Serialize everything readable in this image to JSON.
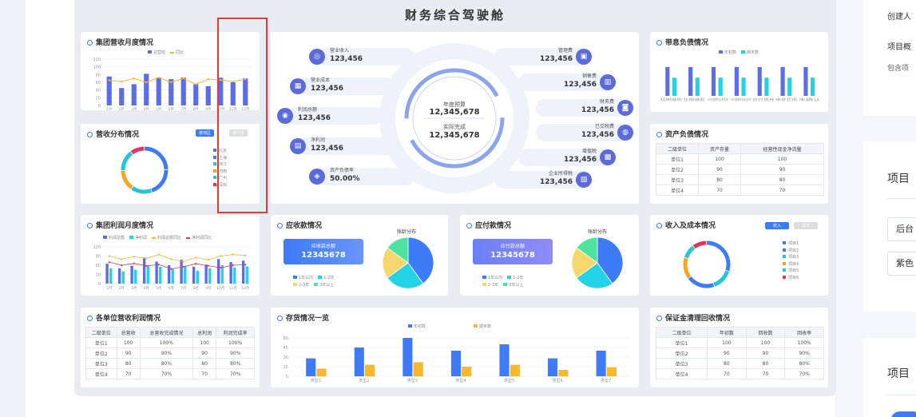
{
  "dashboard": {
    "title": "财务综合驾驶舱",
    "revenue_month": {
      "title": "集团营收月度情况",
      "legend": [
        "总营收",
        "同比"
      ],
      "y_ticks": [
        "120",
        "100",
        "80",
        "60",
        "40",
        "20",
        "0"
      ],
      "months": [
        "1月",
        "2月",
        "3月",
        "4月",
        "5月",
        "6月",
        "7月",
        "8月",
        "9月",
        "10月",
        "11月",
        "12月"
      ],
      "colors": {
        "bar": "#5b6ee8",
        "line": "#f5b830"
      }
    },
    "revenue_dist": {
      "title": "营收分布情况",
      "toggle": [
        "按地区",
        "按行业"
      ],
      "legend": [
        "北京",
        "上海",
        "浙江",
        "河南",
        "广州",
        "深圳"
      ],
      "colors": [
        "#3d7bf7",
        "#3d7bf7",
        "#22c6d6",
        "#f5a623",
        "#22c6d6",
        "#e8345a"
      ]
    },
    "center": {
      "budget_label": "年度预算",
      "budget_value": "12,345,678",
      "actual_label": "实际完成",
      "actual_value": "12,345,678",
      "left_items": [
        {
          "label": "营业收入",
          "value": "123,456",
          "icon": "◎"
        },
        {
          "label": "营业成本",
          "value": "123,456",
          "icon": "▦"
        },
        {
          "label": "利润总额",
          "value": "123,456",
          "icon": "◉"
        },
        {
          "label": "净利润",
          "value": "123,456",
          "icon": "▤"
        },
        {
          "label": "资产负债率",
          "value": "50.00%",
          "icon": "◈"
        }
      ],
      "right_items": [
        {
          "label": "管理费",
          "value": "123,456",
          "icon": "▣"
        },
        {
          "label": "销售费",
          "value": "123,456",
          "icon": "▥"
        },
        {
          "label": "财务费",
          "value": "123,456",
          "icon": "◙"
        },
        {
          "label": "已交税费",
          "value": "123,456",
          "icon": "◍"
        },
        {
          "label": "增值税",
          "value": "123,456",
          "icon": "▩"
        },
        {
          "label": "企业所得税",
          "value": "123,456",
          "icon": "▧"
        }
      ]
    },
    "debt_status": {
      "title": "带息负债情况",
      "legend": [
        "年初数",
        "期末数"
      ],
      "categories": [
        "短期借款",
        "长期借款",
        "一年内到期的长期负债",
        "一年内到期的非流动负债",
        "应付债券",
        "带息负债",
        "未确认"
      ]
    },
    "asset_debt": {
      "title": "资产负债情况",
      "headers": [
        "二级单位",
        "资产存量",
        "经营性现金净流量"
      ],
      "rows": [
        [
          "单位1",
          "100",
          "100"
        ],
        [
          "单位2",
          "90",
          "90"
        ],
        [
          "单位3",
          "80",
          "80"
        ],
        [
          "单位4",
          "70",
          "70"
        ]
      ]
    },
    "profit_month": {
      "title": "集团利润月度情况",
      "legend": [
        "利润总额",
        "净利润",
        "利润总额同比",
        "净利润同比"
      ],
      "y_ticks": [
        "120",
        "90",
        "60",
        "30",
        "0"
      ],
      "months": [
        "1月",
        "2月",
        "3月",
        "4月",
        "5月",
        "6月",
        "7月",
        "8月",
        "9月",
        "10月",
        "11月",
        "12月"
      ]
    },
    "receivable": {
      "title": "应收款情况",
      "box_label": "应收款总额",
      "box_value": "12345678",
      "age_title": "账龄分布",
      "legend": [
        "1年以内",
        "1-2年",
        "2-3年",
        "3年以上"
      ]
    },
    "payable": {
      "title": "应付款情况",
      "box_label": "应付款总额",
      "box_value": "12345678",
      "age_title": "账龄分布",
      "legend": [
        "1年以内",
        "1-2年",
        "2-3年",
        "3年以上"
      ]
    },
    "income_cost": {
      "title": "收入及成本情况",
      "toggle": [
        "收入",
        "成本"
      ],
      "legend": [
        "项目1",
        "项目2",
        "项目3",
        "项目4",
        "项目5",
        "项目6"
      ]
    },
    "unit_profit": {
      "title": "各单位营收利润情况",
      "headers": [
        "二级单位",
        "总营收",
        "总营收完成情况",
        "总利润",
        "利润完成率"
      ],
      "rows": [
        [
          "单位1",
          "100",
          "100%",
          "100",
          "100%"
        ],
        [
          "单位2",
          "90",
          "90%",
          "90",
          "90%"
        ],
        [
          "单位3",
          "80",
          "80%",
          "80",
          "80%"
        ],
        [
          "单位4",
          "70",
          "70%",
          "70",
          "70%"
        ]
      ]
    },
    "inventory": {
      "title": "存货情况一览",
      "legend": [
        "年初数",
        "期末数"
      ],
      "y_ticks": [
        "60",
        "45",
        "30",
        "15",
        "0"
      ],
      "categories": [
        "类型1",
        "类型2",
        "类型3",
        "类型4",
        "类型5",
        "类型6",
        "类型7"
      ]
    },
    "deposit": {
      "title": "保证金清理回收情况",
      "headers": [
        "二级单位",
        "年初数",
        "回收数",
        "回收率"
      ],
      "rows": [
        [
          "单位1",
          "100",
          "100",
          "100%"
        ],
        [
          "单位2",
          "90",
          "90",
          "90%"
        ],
        [
          "单位3",
          "80",
          "80",
          "80%"
        ],
        [
          "单位4",
          "70",
          "70",
          "70%"
        ]
      ]
    }
  },
  "chart_data": [
    {
      "type": "bar",
      "title": "集团营收月度情况",
      "categories": [
        "1月",
        "2月",
        "3月",
        "4月",
        "5月",
        "6月",
        "7月",
        "8月",
        "9月",
        "10月",
        "11月",
        "12月"
      ],
      "series": [
        {
          "name": "总营收",
          "values": [
            75,
            45,
            55,
            82,
            72,
            68,
            72,
            55,
            50,
            72,
            60,
            70
          ]
        },
        {
          "name": "同比",
          "values": [
            65,
            62,
            70,
            60,
            72,
            60,
            70,
            55,
            68,
            66,
            62,
            68
          ]
        }
      ],
      "ylim": [
        0,
        120
      ]
    },
    {
      "type": "pie",
      "title": "营收分布情况",
      "categories": [
        "北京",
        "上海",
        "浙江",
        "河南",
        "广州",
        "深圳"
      ],
      "values": [
        25,
        20,
        15,
        15,
        15,
        10
      ]
    },
    {
      "type": "bar",
      "title": "带息负债情况",
      "categories": [
        "短期借款",
        "长期借款",
        "一年内到期的长期负债",
        "一年内到期的非流动负债",
        "应付债券",
        "带息负债",
        "未确认"
      ],
      "series": [
        {
          "name": "年初数",
          "values": [
            95,
            95,
            95,
            95,
            95,
            95,
            95
          ]
        },
        {
          "name": "期末数",
          "values": [
            60,
            60,
            60,
            60,
            60,
            60,
            60
          ]
        }
      ],
      "ylim": [
        0,
        100
      ]
    },
    {
      "type": "bar",
      "title": "集团利润月度情况",
      "categories": [
        "1月",
        "2月",
        "3月",
        "4月",
        "5月",
        "6月",
        "7月",
        "8月",
        "9月",
        "10月",
        "11月",
        "12月"
      ],
      "series": [
        {
          "name": "利润总额",
          "values": [
            65,
            50,
            58,
            85,
            72,
            60,
            78,
            55,
            62,
            80,
            70,
            75
          ]
        },
        {
          "name": "净利润",
          "values": [
            50,
            40,
            45,
            60,
            55,
            48,
            58,
            42,
            50,
            60,
            52,
            56
          ]
        },
        {
          "name": "利润总额同比",
          "values": [
            90,
            80,
            88,
            82,
            95,
            80,
            72,
            85,
            78,
            90,
            95,
            92
          ]
        },
        {
          "name": "净利润同比",
          "values": [
            70,
            60,
            66,
            58,
            62,
            48,
            55,
            65,
            58,
            52,
            60,
            62
          ]
        }
      ],
      "ylim": [
        0,
        120
      ]
    },
    {
      "type": "pie",
      "title": "应收款账龄分布",
      "categories": [
        "1年以内",
        "1-2年",
        "2-3年",
        "3年以上"
      ],
      "values": [
        40,
        25,
        20,
        15
      ]
    },
    {
      "type": "pie",
      "title": "应付款账龄分布",
      "categories": [
        "1年以内",
        "1-2年",
        "2-3年",
        "3年以上"
      ],
      "values": [
        40,
        25,
        20,
        15
      ]
    },
    {
      "type": "pie",
      "title": "收入及成本情况",
      "categories": [
        "项目1",
        "项目2",
        "项目3",
        "项目4",
        "项目5",
        "项目6"
      ],
      "values": [
        30,
        15,
        20,
        15,
        10,
        10
      ]
    },
    {
      "type": "bar",
      "title": "存货情况一览",
      "categories": [
        "类型1",
        "类型2",
        "类型3",
        "类型4",
        "类型5",
        "类型6",
        "类型7"
      ],
      "series": [
        {
          "name": "年初数",
          "values": [
            28,
            45,
            60,
            40,
            50,
            28,
            40
          ]
        },
        {
          "name": "期末数",
          "values": [
            12,
            18,
            22,
            15,
            18,
            10,
            14
          ]
        }
      ],
      "ylim": [
        0,
        60
      ]
    }
  ],
  "right_panel": {
    "creator_label": "创建人",
    "overview_label": "项目概",
    "contains_label": "包含项",
    "section1_title": "项目",
    "input1_value": "后台",
    "input2_value": "紫色",
    "section2_title": "项目"
  }
}
